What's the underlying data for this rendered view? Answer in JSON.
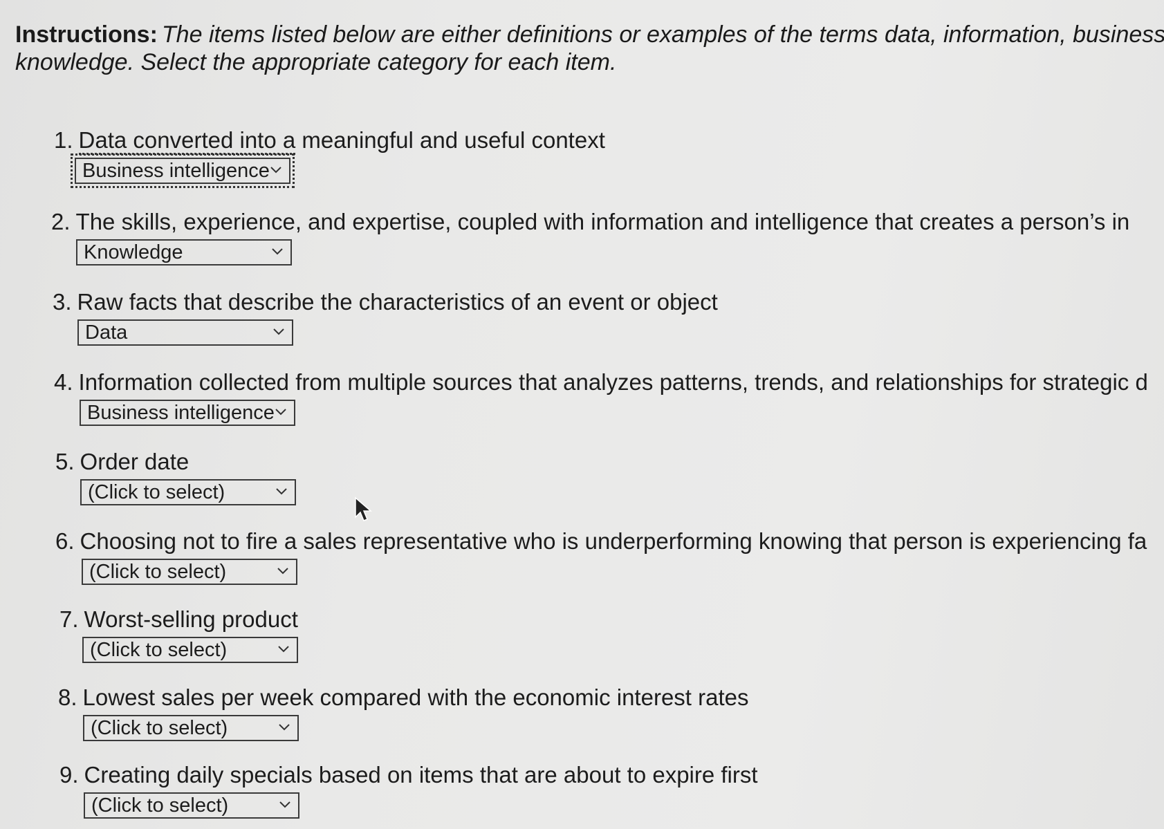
{
  "instructions": {
    "label": "Instructions:",
    "text_line1": "The items listed below are either definitions or examples of the terms data, information, business",
    "text_line2": "knowledge. Select the appropriate category for each item."
  },
  "items": [
    {
      "number": "1.",
      "text_a": "Data converted into a",
      "text_b": " meaningful and useful context",
      "selected": "Business intelligence"
    },
    {
      "number": "2.",
      "text": "The skills, experience, and expertise, coupled with information and intelligence that creates a person’s in",
      "selected": "Knowledge"
    },
    {
      "number": "3.",
      "text": "Raw facts that describe the characteristics of an event or object",
      "selected": "Data"
    },
    {
      "number": "4.",
      "text": "Information collected from multiple sources that analyzes patterns, trends, and relationships for strategic d",
      "selected": "Business intelligence"
    },
    {
      "number": "5.",
      "text": "Order date",
      "selected": "(Click to select)"
    },
    {
      "number": "6.",
      "text": "Choosing not to fire a sales representative who is underperforming knowing that person is experiencing fa",
      "selected": "(Click to select)"
    },
    {
      "number": "7.",
      "text": "Worst-selling product",
      "selected": "(Click to select)"
    },
    {
      "number": "8.",
      "text": "Lowest sales per week compared with the economic interest rates",
      "selected": "(Click to select)"
    },
    {
      "number": "9.",
      "text": "Creating daily specials based on items that are about to expire first",
      "selected": "(Click to select)"
    }
  ],
  "icons": {
    "dropdown": "chevron-down-icon",
    "pointer": "mouse-pointer-icon"
  },
  "colors": {
    "background": "#e8e8e7",
    "text": "#1c1c1c",
    "select_border": "#3a3a3a"
  }
}
